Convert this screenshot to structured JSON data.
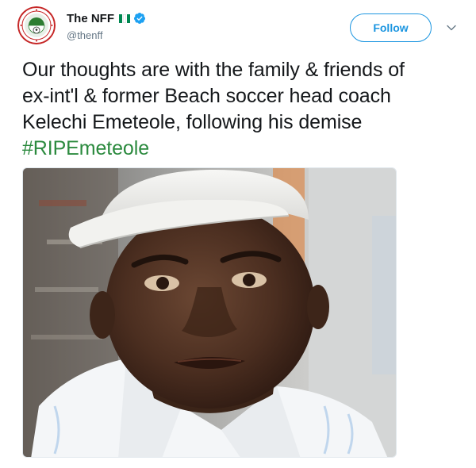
{
  "account": {
    "display_name": "The NFF",
    "handle": "@thenff",
    "verified": true,
    "avatar_icon": "nff-logo-icon",
    "flag_icon": "nigeria-flag-icon",
    "flag_colors": [
      "#008751",
      "#ffffff",
      "#008751"
    ]
  },
  "actions": {
    "follow_label": "Follow",
    "more_icon": "chevron-down-icon"
  },
  "tweet": {
    "lines": [
      "Our thoughts are with the family & friends of",
      "ex-int'l & former Beach soccer head coach",
      "Kelechi Emeteole, following his demise"
    ],
    "hashtag": "#RIPEmeteole"
  },
  "media": {
    "type": "photo"
  },
  "colors": {
    "link_blue": "#1b95e0",
    "hashtag_green": "#2b8a3e",
    "text": "#14171a",
    "secondary_text": "#657786"
  }
}
